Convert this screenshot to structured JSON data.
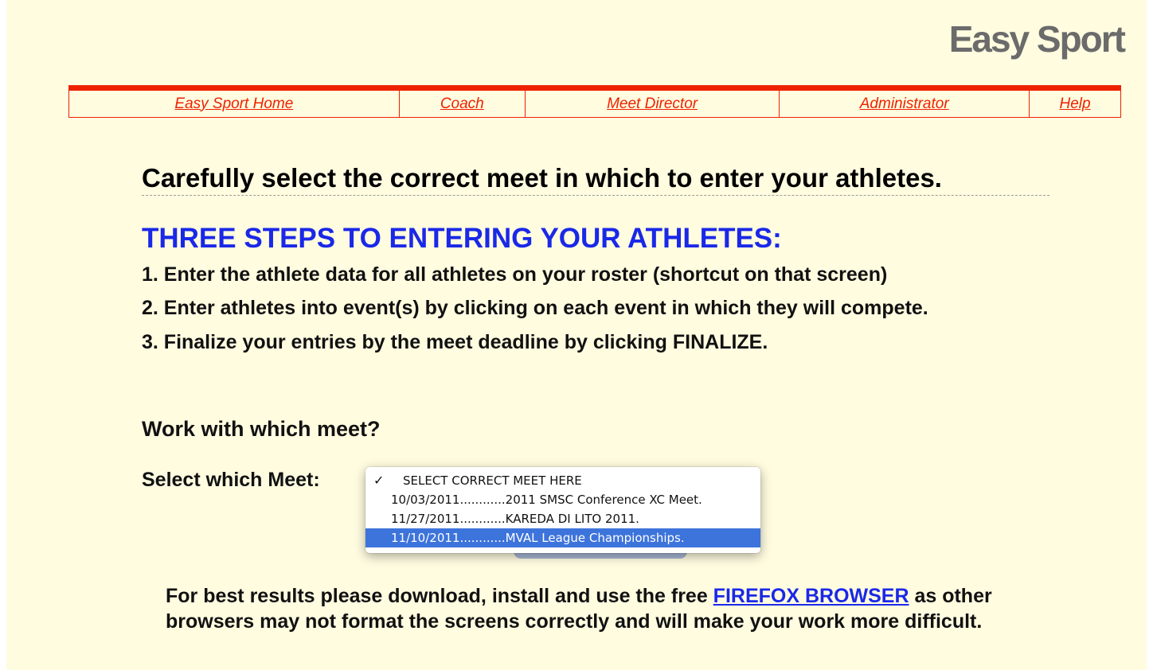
{
  "logo": "Easy Sport",
  "nav": [
    {
      "label": "Easy Sport Home"
    },
    {
      "label": "Coach"
    },
    {
      "label": "Meet Director"
    },
    {
      "label": "Administrator"
    },
    {
      "label": "Help"
    }
  ],
  "heading": "Carefully select the correct meet in which to enter your athletes.",
  "steps_title": "THREE STEPS TO ENTERING YOUR ATHLETES:",
  "steps": [
    "1. Enter the athlete data for all athletes on your roster (shortcut on that screen)",
    "2. Enter athletes into event(s) by clicking on each event in which they will compete.",
    "3. Finalize your entries by the meet deadline by clicking FINALIZE."
  ],
  "question": "Work with which meet?",
  "select_label": "Select which Meet:",
  "meet_select": {
    "check": "✓",
    "options": [
      "SELECT CORRECT MEET HERE",
      "10/03/2011............2011 SMSC Conference XC Meet.",
      "11/27/2011............KAREDA DI LITO 2011.",
      "11/10/2011............MVAL League Championships."
    ],
    "highlighted_index": 3
  },
  "note": {
    "before": "For best results please download, install and use the free ",
    "link": "FIREFOX BROWSER",
    "after": " as other browsers may not format the screens correctly and will make your work more difficult."
  },
  "colors": {
    "background": "#fffce0",
    "accent_red": "#ee2200",
    "heading_blue": "#1a28e8",
    "highlight": "#3d74db"
  }
}
